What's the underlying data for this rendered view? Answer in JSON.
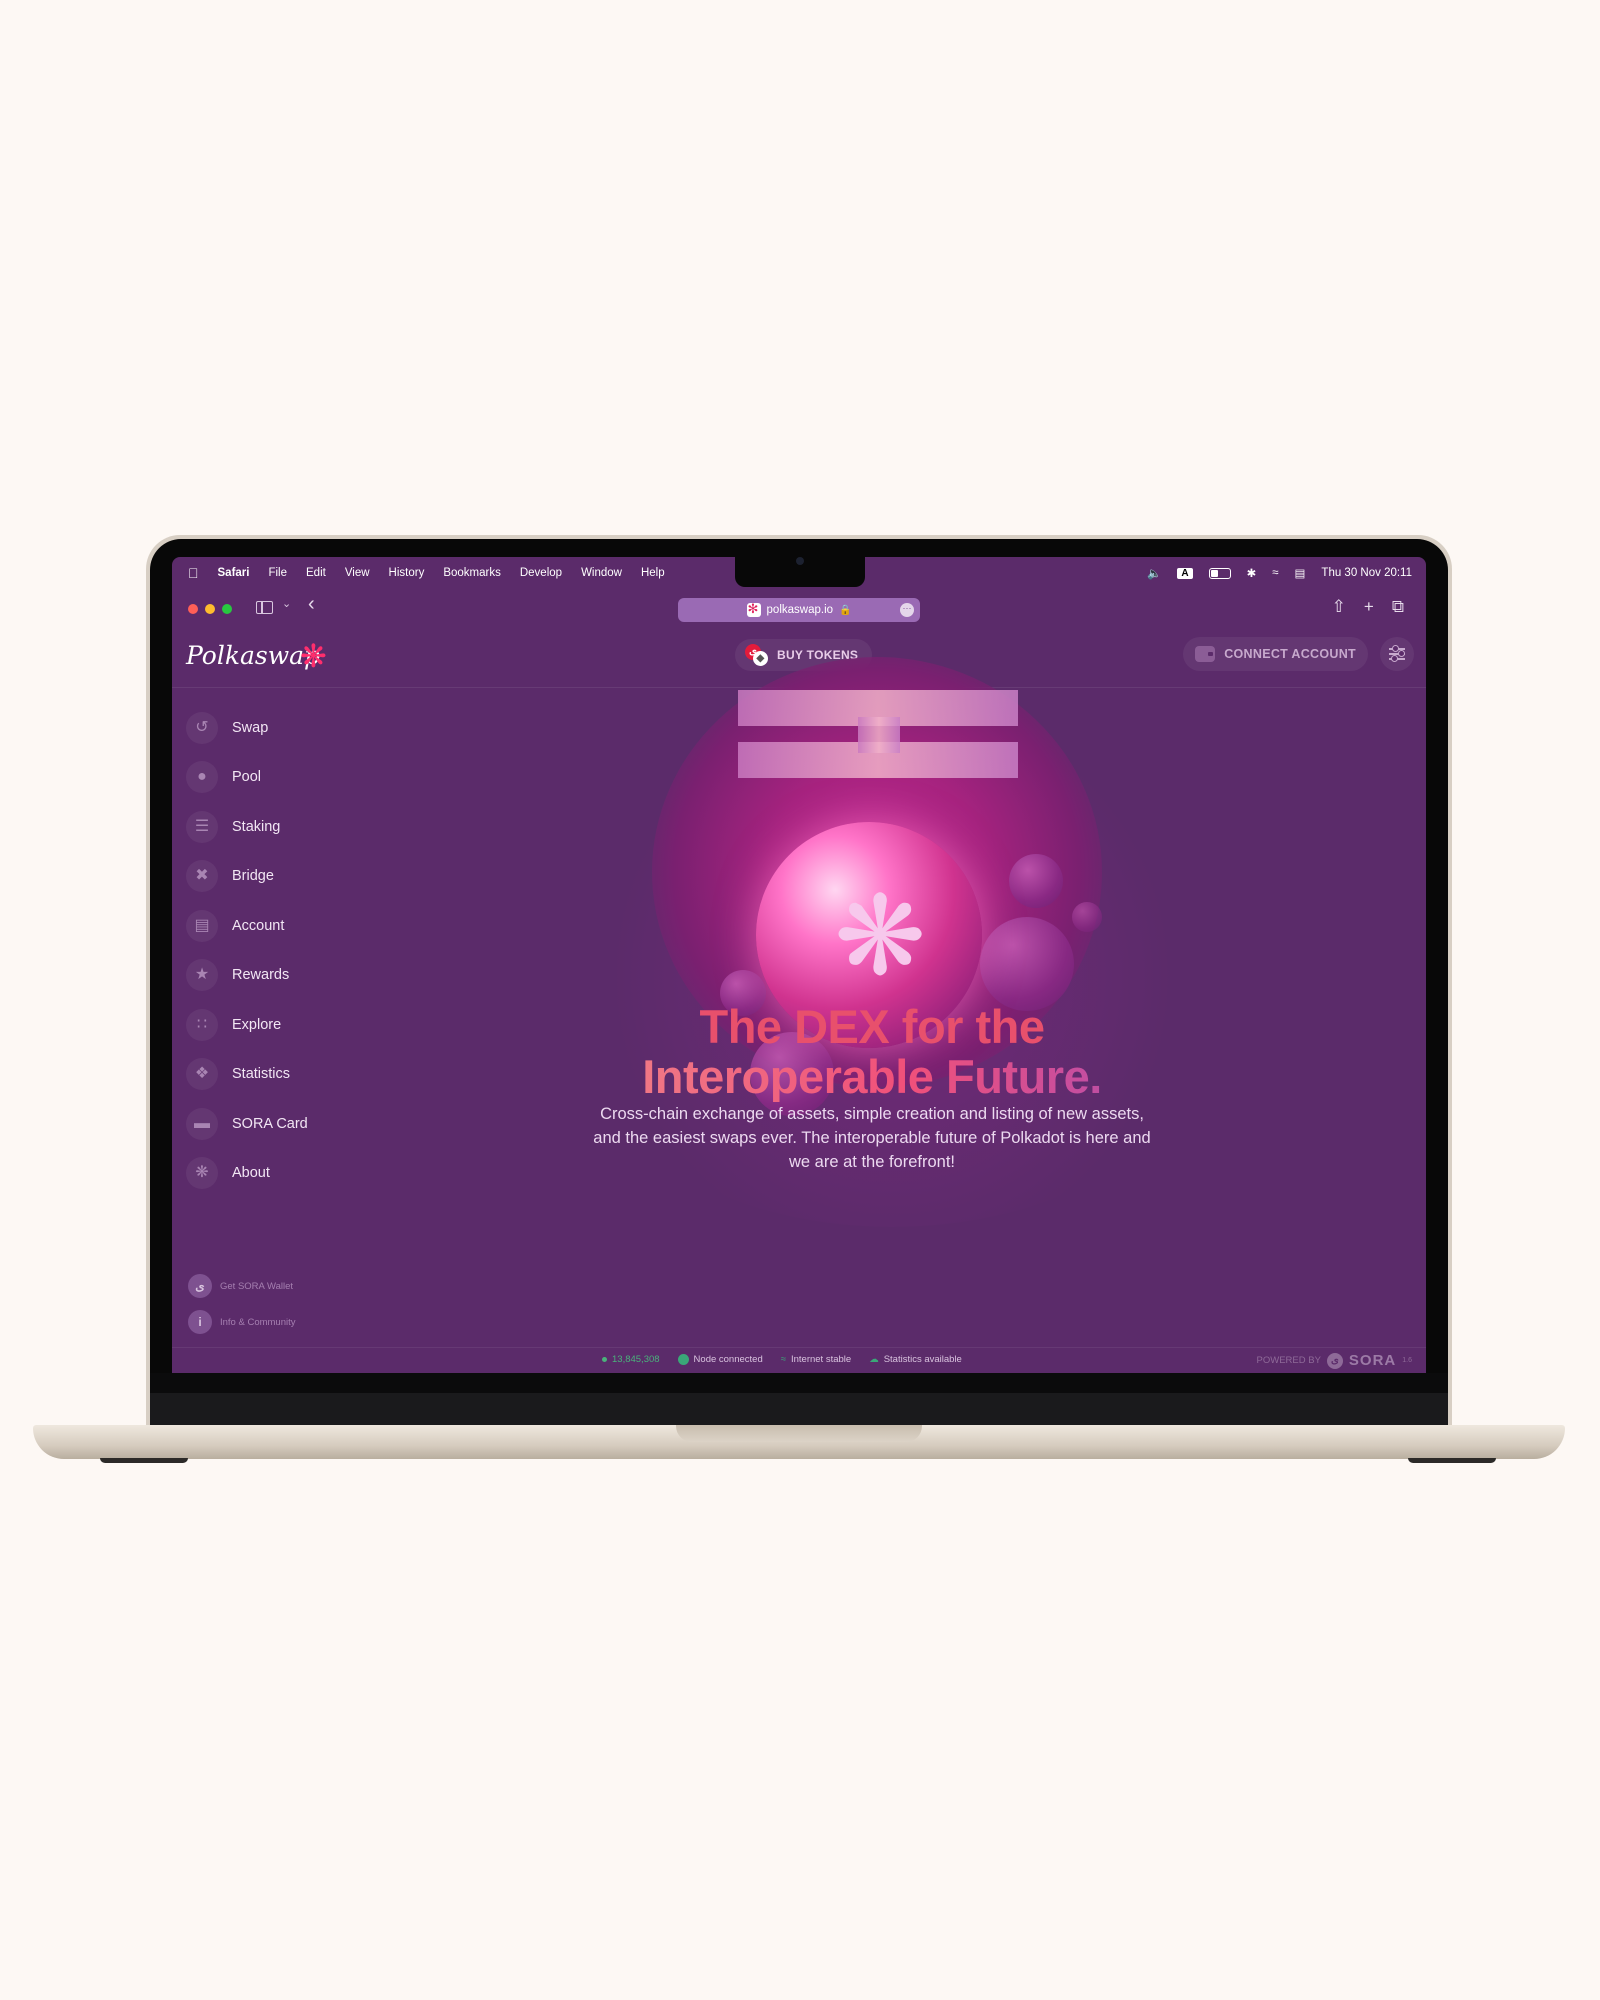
{
  "menubar": {
    "app_name": "Safari",
    "menus": [
      "File",
      "Edit",
      "View",
      "History",
      "Bookmarks",
      "Develop",
      "Window",
      "Help"
    ],
    "input_source": "A",
    "datetime": "Thu 30 Nov  20:11"
  },
  "browser": {
    "url": "polkaswap.io",
    "traffic_colors": [
      "#ff5f57",
      "#febc2e",
      "#28c840"
    ]
  },
  "header": {
    "logo_text": "Polkaswap",
    "buy_tokens_label": "BUY TOKENS",
    "connect_account_label": "CONNECT ACCOUNT"
  },
  "sidebar": {
    "items": [
      {
        "label": "Swap",
        "icon": "swap-icon"
      },
      {
        "label": "Pool",
        "icon": "drop-icon"
      },
      {
        "label": "Staking",
        "icon": "layers-icon"
      },
      {
        "label": "Bridge",
        "icon": "bridge-icon"
      },
      {
        "label": "Account",
        "icon": "wallet-icon"
      },
      {
        "label": "Rewards",
        "icon": "star-icon"
      },
      {
        "label": "Explore",
        "icon": "grid-icon"
      },
      {
        "label": "Statistics",
        "icon": "diamond-icon"
      },
      {
        "label": "SORA Card",
        "icon": "card-icon"
      },
      {
        "label": "About",
        "icon": "flower-icon"
      }
    ],
    "footer": {
      "get_wallet": "Get SORA Wallet",
      "info_community": "Info & Community"
    }
  },
  "hero": {
    "title_line1": "The DEX for the",
    "title_line2": "Interoperable Future.",
    "subtitle": "Cross-chain exchange of assets, simple creation and listing of new assets, and the easiest swaps ever. The interoperable future of Polkadot is here and we are at the forefront!"
  },
  "status": {
    "block_number": "13,845,308",
    "node": "Node connected",
    "internet": "Internet stable",
    "statistics": "Statistics available",
    "powered_by": "POWERED BY",
    "powered_brand": "SORA",
    "powered_version": "1.6"
  },
  "colors": {
    "app_background": "#5b2b6a",
    "accent_pink": "#ff2e6d",
    "status_green": "#4ab27b"
  }
}
